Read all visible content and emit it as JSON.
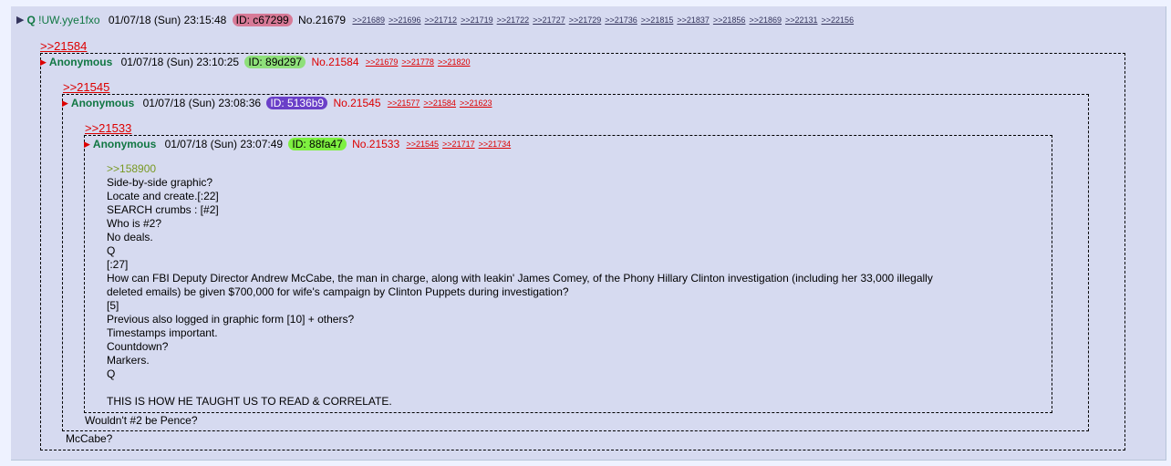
{
  "op": {
    "name": "Q",
    "tripcode": "!UW.yye1fxo",
    "date": "01/07/18 (Sun) 23:15:48",
    "id": "ID: c67299",
    "id_color": "#d77a97",
    "post_no": "No.21679",
    "backlinks": [
      ">>21689",
      ">>21696",
      ">>21712",
      ">>21719",
      ">>21722",
      ">>21727",
      ">>21729",
      ">>21736",
      ">>21815",
      ">>21837",
      ">>21856",
      ">>21869",
      ">>22131",
      ">>22156"
    ]
  },
  "level1": {
    "quote": ">>21584",
    "name": "Anonymous",
    "date": "01/07/18 (Sun) 23:10:25",
    "id": "ID: 89d297",
    "id_color": "#8ee07a",
    "post_no": "No.21584",
    "backlinks": [
      ">>21679",
      ">>21778",
      ">>21820"
    ],
    "reply": "McCabe?"
  },
  "level2": {
    "quote": ">>21545",
    "name": "Anonymous",
    "date": "01/07/18 (Sun) 23:08:36",
    "id": "ID: 5136b9",
    "id_color": "#6a3fc8",
    "post_no": "No.21545",
    "backlinks": [
      ">>21577",
      ">>21584",
      ">>21623"
    ],
    "reply": "Wouldn't #2 be Pence?"
  },
  "level3": {
    "quote": ">>21533",
    "name": "Anonymous",
    "date": "01/07/18 (Sun) 23:07:49",
    "id": "ID: 88fa47",
    "id_color": "#7ef040",
    "post_no": "No.21533",
    "backlinks": [
      ">>21545",
      ">>21717",
      ">>21734"
    ],
    "greentext": ">>158900",
    "lines": [
      "Side-by-side graphic?",
      "Locate and create.[:22]",
      "SEARCH crumbs : [#2]",
      "Who is #2?",
      "No deals.",
      "Q",
      "[:27]",
      "How can FBI Deputy Director Andrew McCabe, the man in charge, along with leakin' James Comey, of the Phony Hillary Clinton investigation (including her 33,000 illegally",
      "deleted emails) be given $700,000 for wife's campaign by Clinton Puppets during investigation?",
      "[5]",
      "Previous also logged in graphic form [10] + others?",
      "Timestamps important.",
      "Countdown?",
      "Markers.",
      "Q",
      "",
      "THIS IS HOW HE TAUGHT US TO READ & CORRELATE."
    ]
  }
}
